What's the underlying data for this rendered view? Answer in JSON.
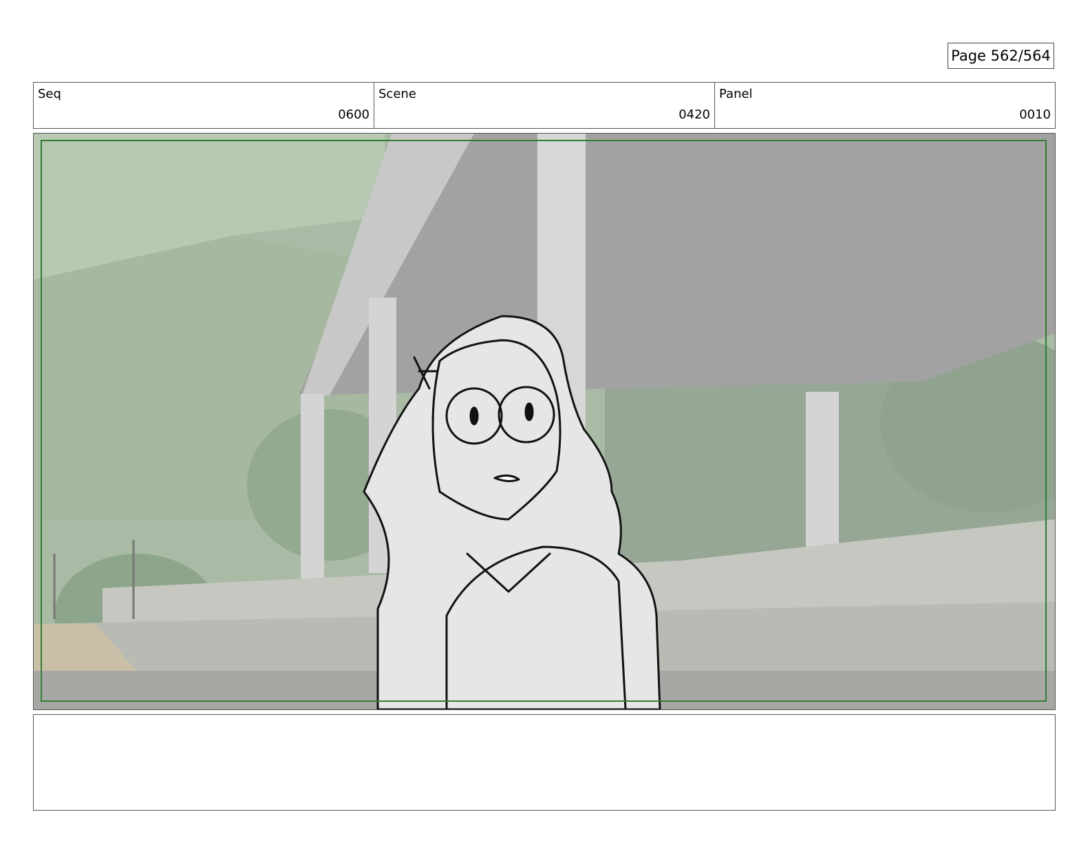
{
  "page": {
    "counter": "Page 562/564"
  },
  "header": {
    "seq_label": "Seq",
    "seq_value": "0600",
    "scene_label": "Scene",
    "scene_value": "0420",
    "panel_label": "Panel",
    "panel_value": "0010"
  },
  "notes": {
    "text": ""
  },
  "colors": {
    "safe_frame": "#2e7d32",
    "hill": "#b7c9b0",
    "foliage": "#93a990",
    "roof": "#a2a2a2",
    "pillar": "#d4d4d4",
    "character_fill": "#e6e6e6"
  }
}
